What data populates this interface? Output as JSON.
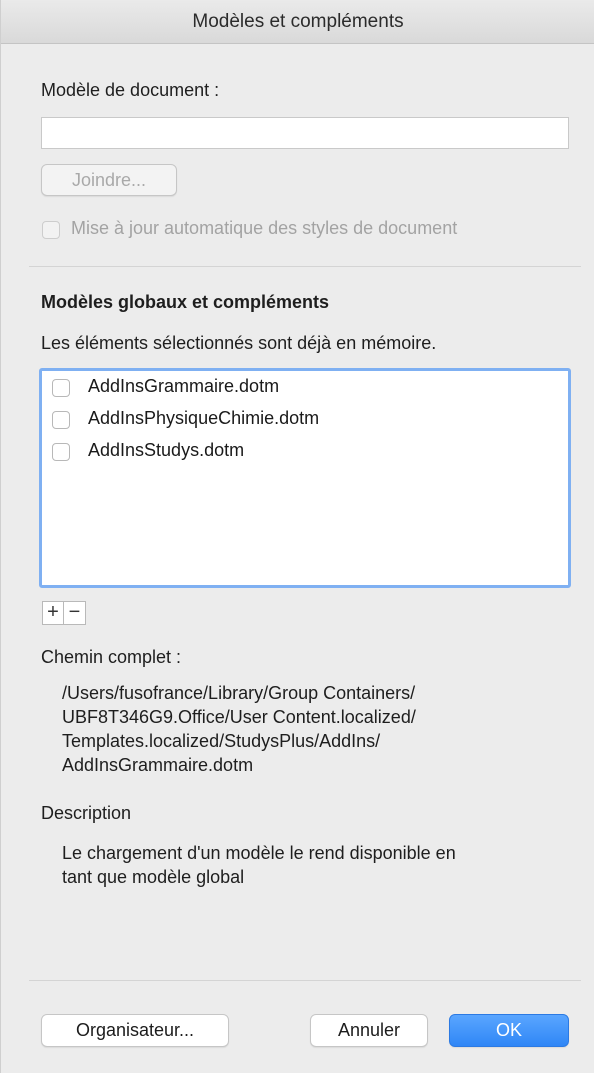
{
  "window": {
    "title": "Modèles et compléments"
  },
  "template_section": {
    "label": "Modèle de document :",
    "field_value": "",
    "attach_button": "Joindre...",
    "auto_update_label": "Mise à jour automatique des styles de document",
    "auto_update_checked": false
  },
  "global_section": {
    "heading": "Modèles globaux et compléments",
    "note": "Les éléments sélectionnés sont déjà en mémoire.",
    "items": [
      {
        "label": "AddInsGrammaire.dotm",
        "checked": false
      },
      {
        "label": "AddInsPhysiqueChimie.dotm",
        "checked": false
      },
      {
        "label": "AddInsStudys.dotm",
        "checked": false
      }
    ],
    "add_button": "+",
    "remove_button": "−"
  },
  "path_section": {
    "label": "Chemin complet :",
    "lines": [
      "/Users/fusofrance/Library/Group Containers/",
      "UBF8T346G9.Office/User Content.localized/",
      "Templates.localized/StudysPlus/AddIns/",
      "AddInsGrammaire.dotm"
    ]
  },
  "description_section": {
    "label": "Description",
    "lines": [
      "Le chargement d'un modèle le rend disponible en",
      "tant que modèle global"
    ]
  },
  "footer": {
    "organizer_button": "Organisateur...",
    "cancel_button": "Annuler",
    "ok_button": "OK"
  }
}
